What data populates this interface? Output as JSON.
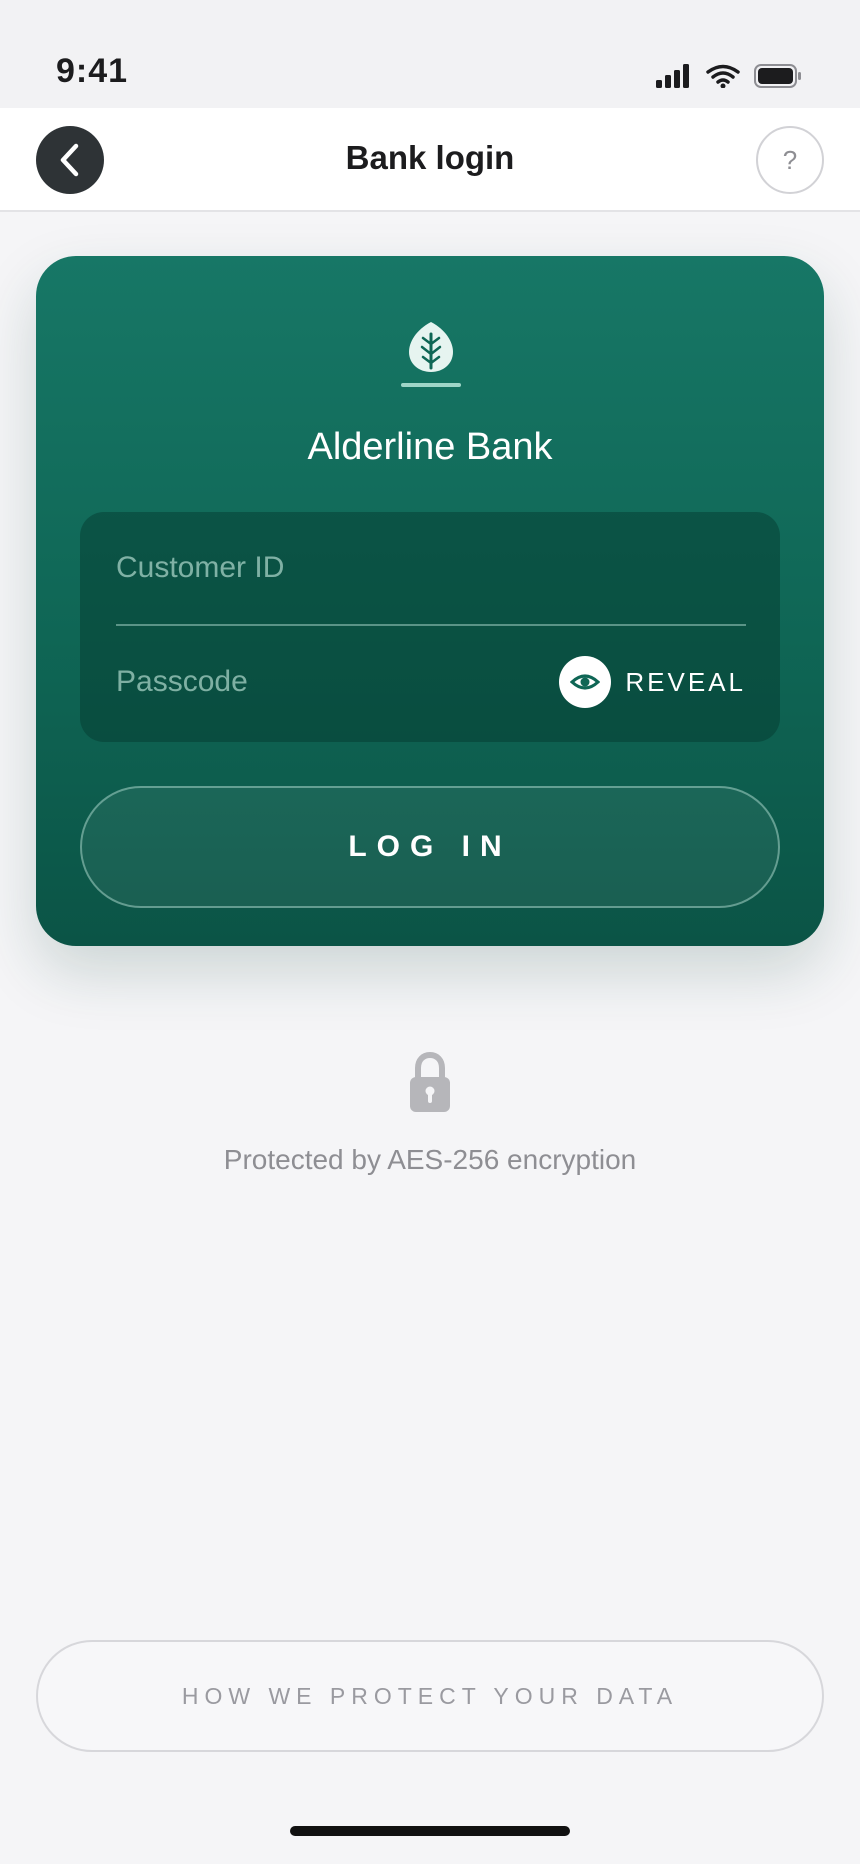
{
  "status_bar": {
    "time": "9:41"
  },
  "nav": {
    "title": "Bank login",
    "help_label": "?"
  },
  "card": {
    "brand_name": "Alderline Bank",
    "customer_id_placeholder": "Customer ID",
    "passcode_placeholder": "Passcode",
    "reveal_label": "REVEAL",
    "login_label": "LOG IN"
  },
  "security": {
    "note": "Protected by AES-256 encryption"
  },
  "footer": {
    "protect_button_label": "HOW WE PROTECT YOUR DATA"
  },
  "icons": {
    "back": "chevron-left-icon",
    "help": "question-mark-icon",
    "brand": "leaf-logo-icon",
    "reveal": "eye-icon",
    "lock": "lock-icon"
  },
  "colors": {
    "card_top": "#177766",
    "card_bottom": "#0b5446",
    "background": "#f5f5f7",
    "back_button": "#2e3336"
  }
}
